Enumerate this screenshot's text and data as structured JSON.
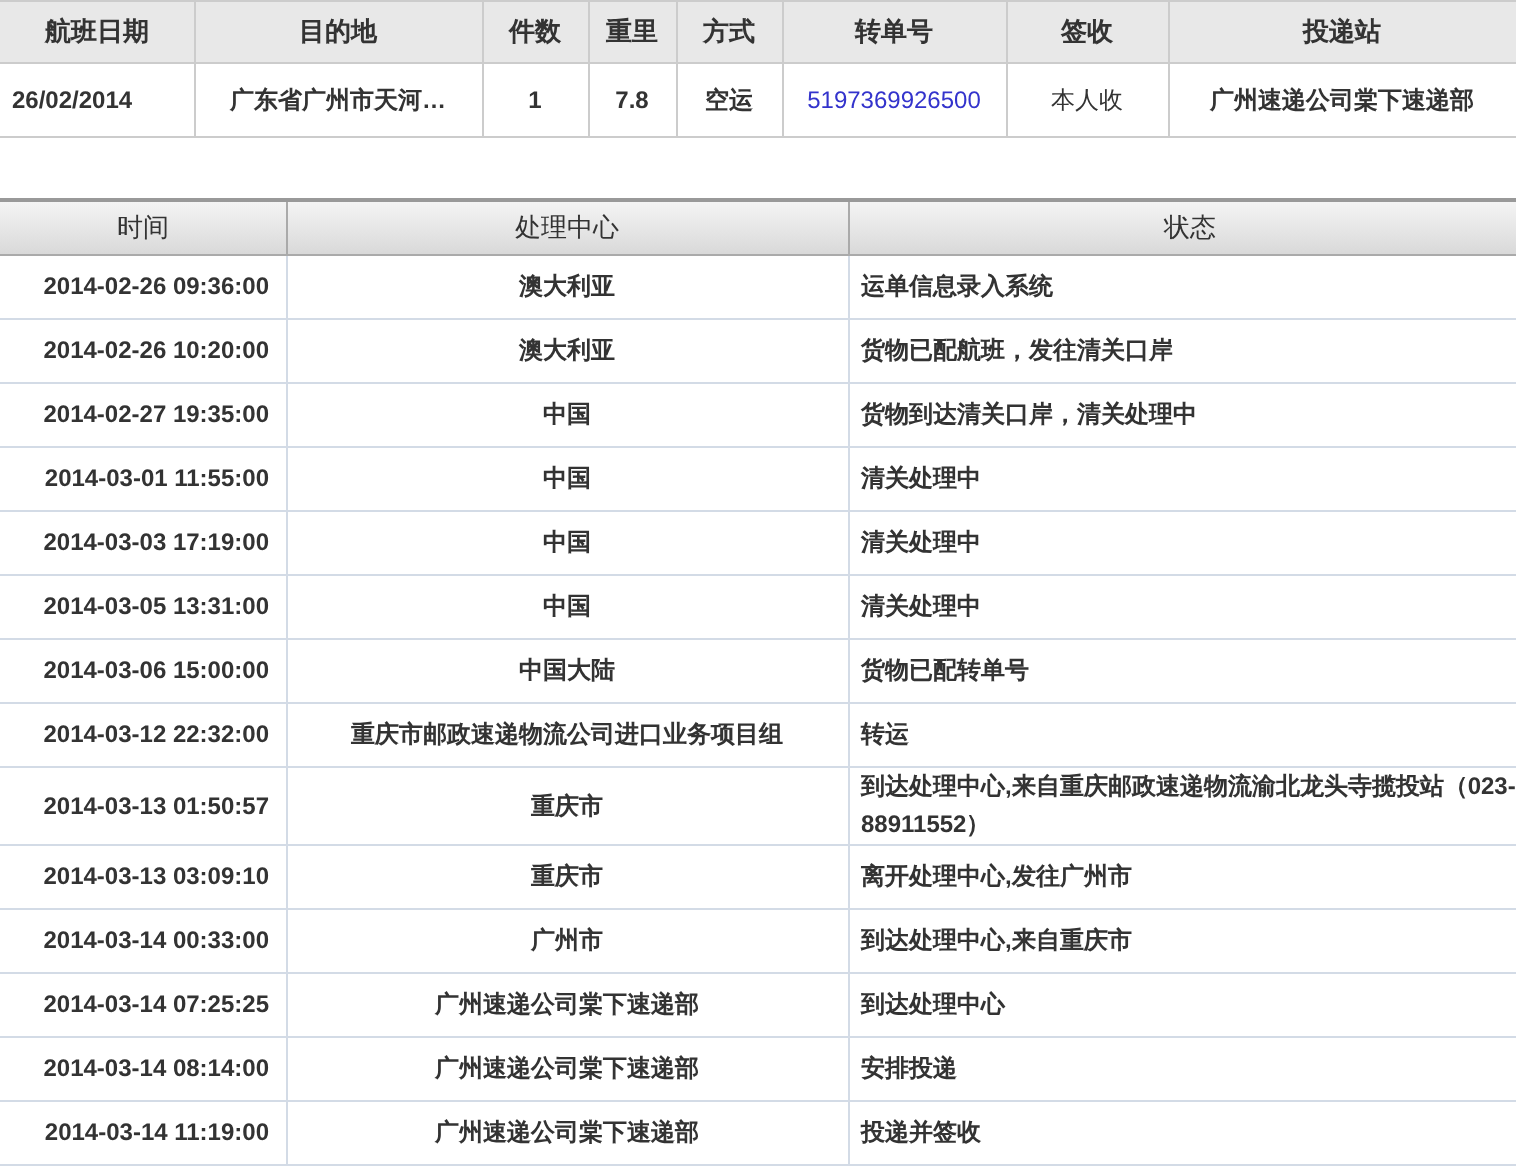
{
  "shipment": {
    "columns": [
      "航班日期",
      "目的地",
      "件数",
      "重里",
      "方式",
      "转单号",
      "签收",
      "投递站"
    ],
    "row": [
      {
        "text": "26/02/2014",
        "kind": "bold"
      },
      {
        "text": "广东省广州市天河…",
        "kind": "bold"
      },
      {
        "text": "1",
        "kind": "bold"
      },
      {
        "text": "7.8",
        "kind": "bold"
      },
      {
        "text": "空运",
        "kind": "bold"
      },
      {
        "text": "5197369926500",
        "kind": "link"
      },
      {
        "text": "本人收",
        "kind": "plain"
      },
      {
        "text": "广州速递公司棠下速递部",
        "kind": "bold"
      }
    ]
  },
  "tracking": {
    "columns": [
      "时间",
      "处理中心",
      "状态"
    ],
    "rows": [
      {
        "time": "2014-02-26 09:36:00",
        "center": "澳大利亚",
        "status": "运单信息录入系统"
      },
      {
        "time": "2014-02-26 10:20:00",
        "center": "澳大利亚",
        "status": "货物已配航班，发往清关口岸"
      },
      {
        "time": "2014-02-27 19:35:00",
        "center": "中国",
        "status": "货物到达清关口岸，清关处理中"
      },
      {
        "time": "2014-03-01 11:55:00",
        "center": "中国",
        "status": "清关处理中"
      },
      {
        "time": "2014-03-03 17:19:00",
        "center": "中国",
        "status": "清关处理中"
      },
      {
        "time": "2014-03-05 13:31:00",
        "center": "中国",
        "status": "清关处理中"
      },
      {
        "time": "2014-03-06 15:00:00",
        "center": "中国大陆",
        "status": "货物已配转单号"
      },
      {
        "time": "2014-03-12 22:32:00",
        "center": "重庆市邮政速递物流公司进口业务项目组",
        "status": "转运"
      },
      {
        "time": "2014-03-13 01:50:57",
        "center": "重庆市",
        "status": "到达处理中心,来自重庆邮政速递物流渝北龙头寺揽投站（023-88911552）"
      },
      {
        "time": "2014-03-13 03:09:10",
        "center": "重庆市",
        "status": "离开处理中心,发往广州市"
      },
      {
        "time": "2014-03-14 00:33:00",
        "center": "广州市",
        "status": "到达处理中心,来自重庆市"
      },
      {
        "time": "2014-03-14 07:25:25",
        "center": "广州速递公司棠下速递部",
        "status": "到达处理中心"
      },
      {
        "time": "2014-03-14 08:14:00",
        "center": "广州速递公司棠下速递部",
        "status": "安排投递"
      },
      {
        "time": "2014-03-14 11:19:00",
        "center": "广州速递公司棠下速递部",
        "status": "投递并签收"
      }
    ]
  }
}
